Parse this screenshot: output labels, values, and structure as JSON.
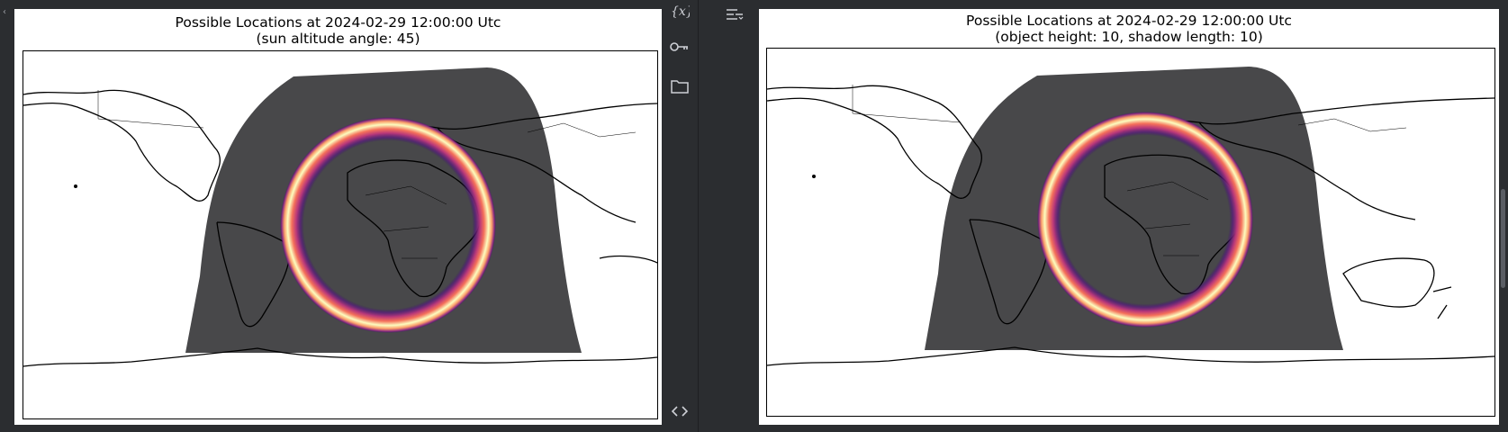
{
  "left_plot": {
    "title_line1": "Possible Locations at 2024-02-29 12:00:00 Utc",
    "title_line2": "(sun altitude angle: 45)"
  },
  "right_plot": {
    "title_line1": "Possible Locations at 2024-02-29 12:00:00 Utc",
    "title_line2": "(object height: 10, shadow length: 10)"
  },
  "toolbar": {
    "icons": [
      "variables-icon",
      "key-icon",
      "folder-icon",
      "code-toggle-icon"
    ]
  },
  "right_toolbar": {
    "icons": [
      "layout-menu-icon"
    ]
  },
  "colors": {
    "night": "#48484a",
    "ring": [
      "#3b0f70",
      "#8c2981",
      "#de4968",
      "#fe9f6d",
      "#fcfdbf"
    ],
    "background": "#2b2d30"
  }
}
